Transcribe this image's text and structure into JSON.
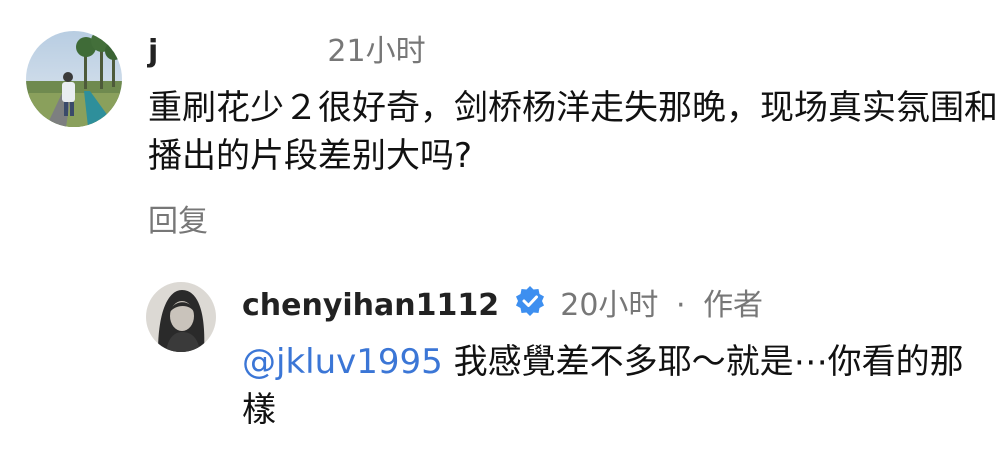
{
  "comment": {
    "username": "j",
    "time": "21小时",
    "text": "重刷花少２很好奇，剑桥杨洋走失那晚，现场真实氛围和播出的片段差别大吗?",
    "reply_label": "回复"
  },
  "reply": {
    "username": "chenyihan1112",
    "verified_icon": "verified-badge-icon",
    "time": "20小时",
    "separator": "·",
    "author_tag": "作者",
    "mention": "@jkluv1995",
    "text": "我感覺差不多耶～就是⋯你看的那樣"
  },
  "colors": {
    "mention": "#3b76d6",
    "meta": "#777777",
    "text": "#111111",
    "verified": "#3d8ff0"
  }
}
